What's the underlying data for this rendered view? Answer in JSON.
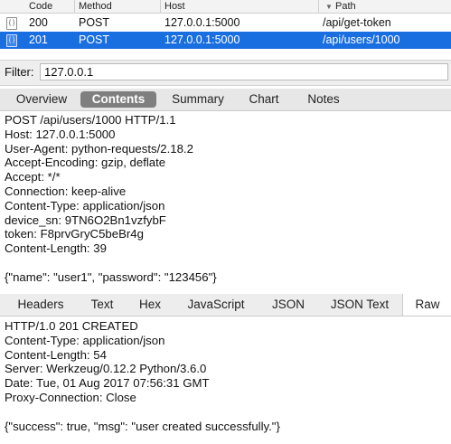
{
  "requests_table": {
    "columns": {
      "code": "Code",
      "method": "Method",
      "host": "Host",
      "path": "Path"
    },
    "rows": [
      {
        "code": "200",
        "method": "POST",
        "host": "127.0.0.1:5000",
        "path": "/api/get-token"
      },
      {
        "code": "201",
        "method": "POST",
        "host": "127.0.0.1:5000",
        "path": "/api/users/1000"
      }
    ]
  },
  "filter": {
    "label": "Filter:",
    "value": "127.0.0.1"
  },
  "request_tabs": [
    "Overview",
    "Contents",
    "Summary",
    "Chart",
    "Notes"
  ],
  "request_active_tab": "Contents",
  "request_body": "POST /api/users/1000 HTTP/1.1\nHost: 127.0.0.1:5000\nUser-Agent: python-requests/2.18.2\nAccept-Encoding: gzip, deflate\nAccept: */*\nConnection: keep-alive\nContent-Type: application/json\ndevice_sn: 9TN6O2Bn1vzfybF\ntoken: F8prvGryC5beBr4g\nContent-Length: 39\n\n{\"name\": \"user1\", \"password\": \"123456\"}",
  "response_tabs": [
    "Headers",
    "Text",
    "Hex",
    "JavaScript",
    "JSON",
    "JSON Text",
    "Raw"
  ],
  "response_active_tab": "Raw",
  "response_body": "HTTP/1.0 201 CREATED\nContent-Type: application/json\nContent-Length: 54\nServer: Werkzeug/0.12.2 Python/3.6.0\nDate: Tue, 01 Aug 2017 07:56:31 GMT\nProxy-Connection: Close\n\n{\"success\": true, \"msg\": \"user created successfully.\"}",
  "colors": {
    "selection": "#1a6fe0",
    "active_tab": "#7f7f7f"
  }
}
